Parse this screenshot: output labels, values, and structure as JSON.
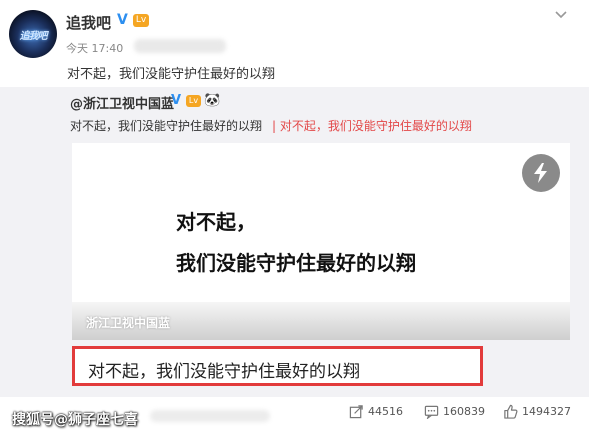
{
  "post": {
    "username": "追我吧",
    "verified_icon": "V",
    "level_badge": "Lv",
    "time": "今天 17:40",
    "content": "对不起，我们没能守护住最好的以翔",
    "avatar_logo": "追我吧"
  },
  "repost": {
    "author": "@浙江卫视中国蓝",
    "verified_icon": "V",
    "level_badge": "Lv",
    "emoji": "🐼",
    "text": "对不起，我们没能守护住最好的以翔",
    "tag": "| 对不起，我们没能守护住最好的以翔",
    "video": {
      "line1": "对不起，",
      "line2": "我们没能守护住最好的以翔",
      "watermark": "浙江卫视中国蓝"
    }
  },
  "highlight_text": "对不起，我们没能守护住最好的以翔",
  "footer_watermark": "搜狐号@狮子座七喜",
  "actions": {
    "repost_count": "44516",
    "comment_count": "160839",
    "like_count": "1494327"
  },
  "colors": {
    "accent_red": "#e23b3b",
    "verified_blue": "#2d8ff0",
    "badge_orange": "#f5a623"
  }
}
